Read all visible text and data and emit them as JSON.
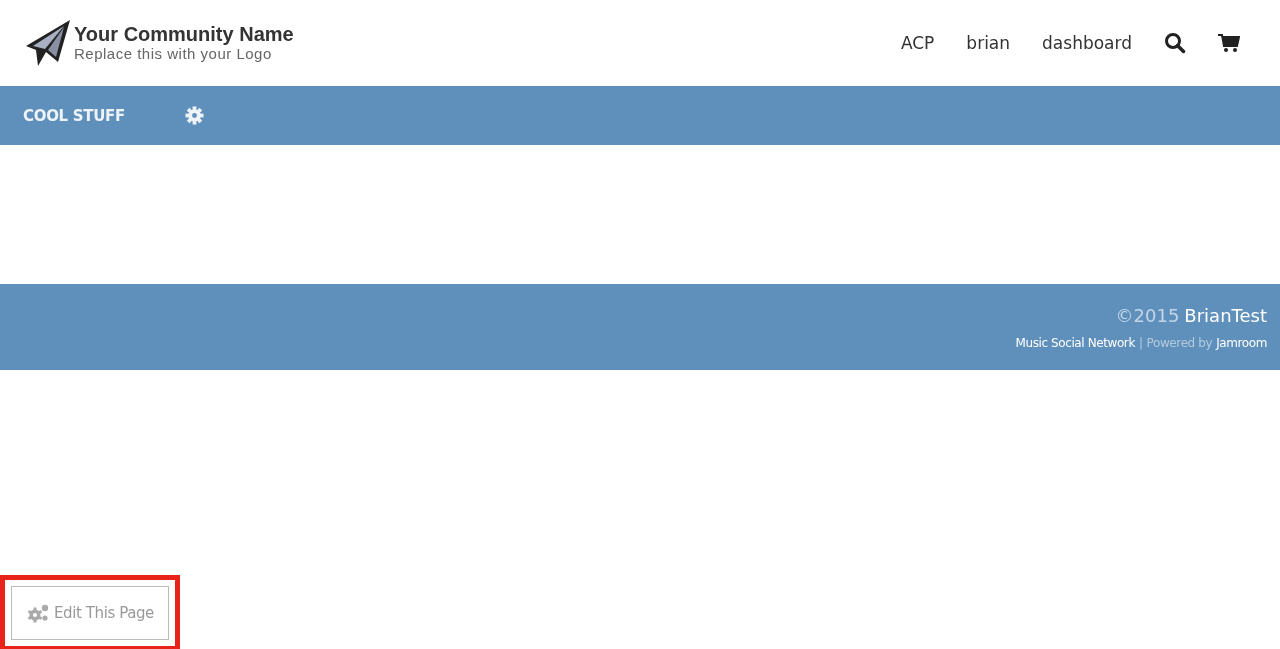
{
  "header": {
    "site_name": "Your Community Name",
    "tagline": "Replace this with your Logo",
    "links": [
      "ACP",
      "brian",
      "dashboard"
    ]
  },
  "nav": {
    "items": [
      {
        "label": "COOL STUFF"
      }
    ]
  },
  "footer": {
    "copyright": "©2015",
    "owner": "BrianTest",
    "links": [
      "Music Social Network",
      "Jamroom"
    ],
    "separator": "|",
    "powered_by": "Powered by"
  },
  "edit_button": {
    "label": "Edit This Page",
    "highlighted": true
  }
}
